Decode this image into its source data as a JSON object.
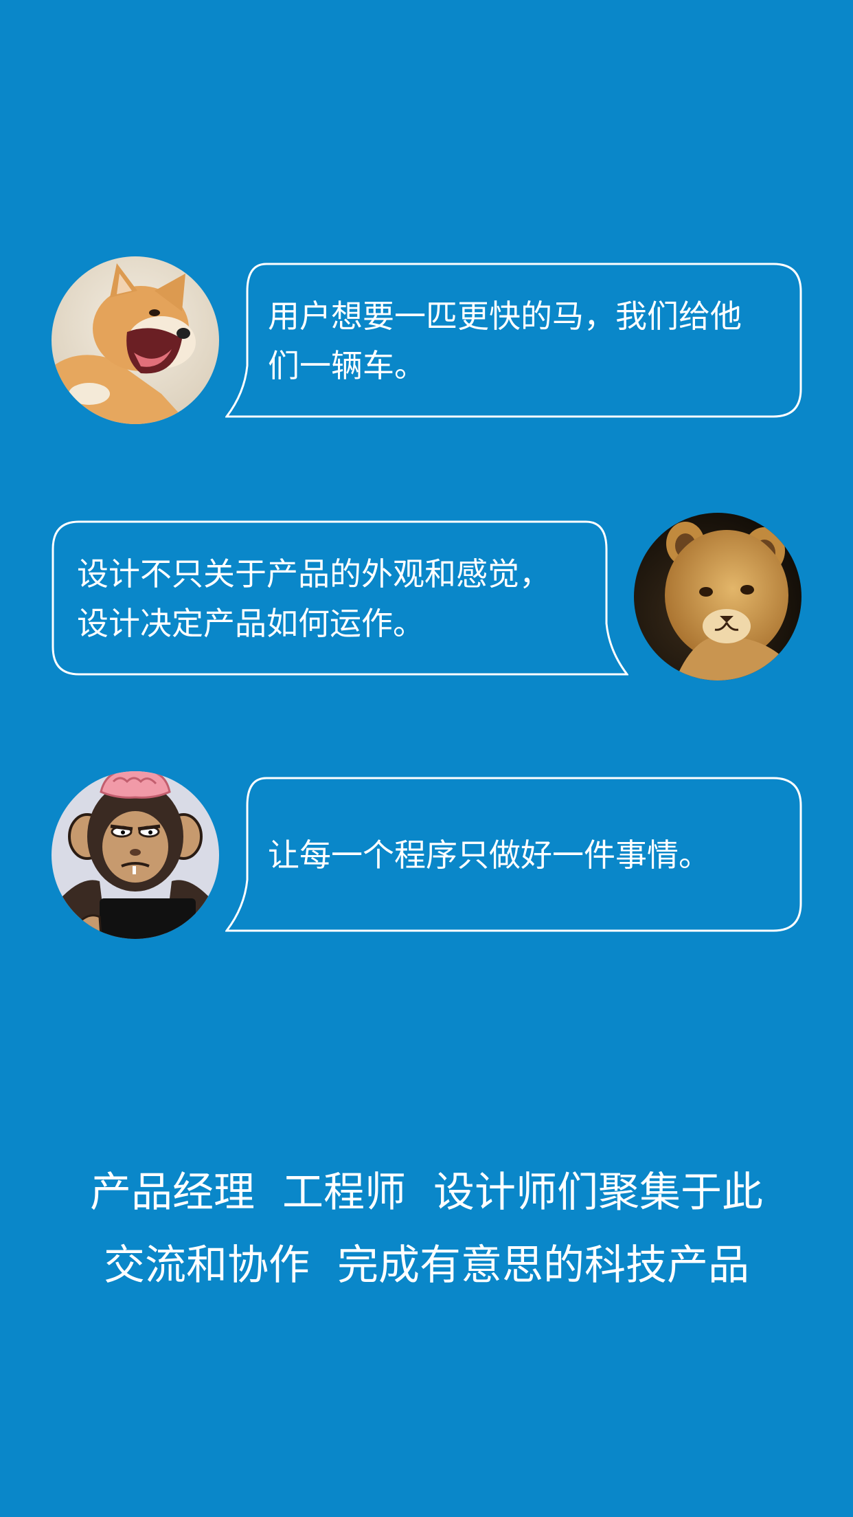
{
  "colors": {
    "background": "#0a87c9",
    "text": "#ffffff",
    "bubble_border": "#ffffff"
  },
  "messages": [
    {
      "avatar": "shiba-dog-avatar",
      "side": "left",
      "line1": "用户想要一匹更快的马，我们给他",
      "line2": "们一辆车。"
    },
    {
      "avatar": "lion-cub-avatar",
      "side": "right",
      "line1": "设计不只关于产品的外观和感觉，",
      "line2": "设计决定产品如何运作。"
    },
    {
      "avatar": "cartoon-monkey-avatar",
      "side": "left",
      "line1": "让每一个程序只做好一件事情。"
    }
  ],
  "slogan": {
    "line1_part1": "产品经理",
    "line1_part2": "工程师",
    "line1_part3": "设计师们聚集于此",
    "line2_part1": "交流和协作",
    "line2_part2": "完成有意思的科技产品"
  }
}
